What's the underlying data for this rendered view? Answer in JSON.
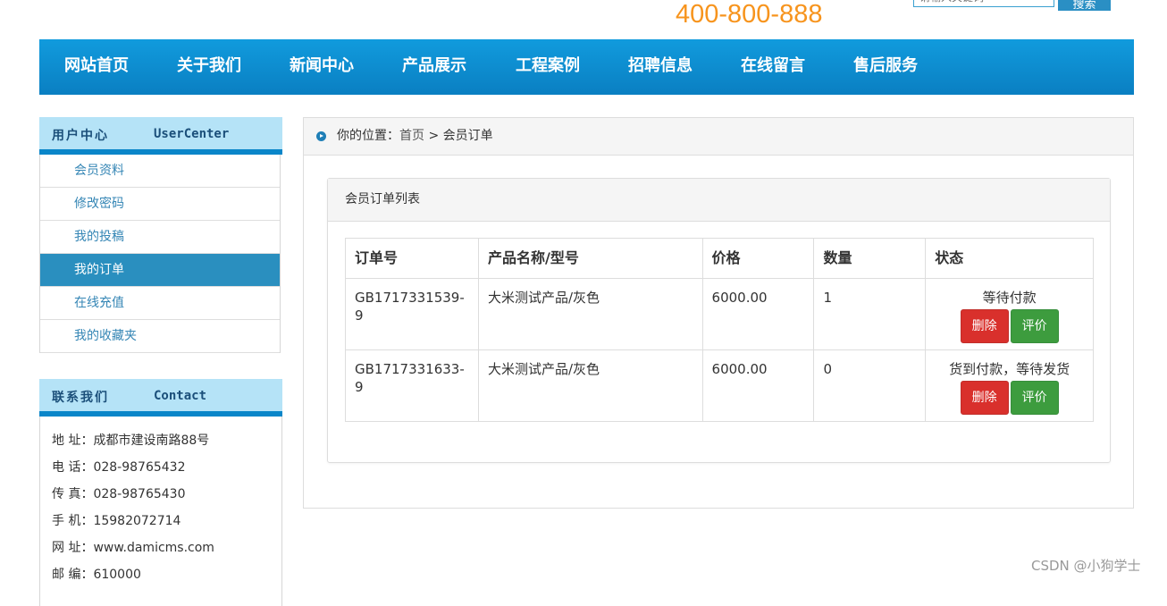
{
  "header": {
    "phone": "400-800-888",
    "search_placeholder": "请输入关键词",
    "search_button": "搜索"
  },
  "nav": {
    "items": [
      "网站首页",
      "关于我们",
      "新闻中心",
      "产品展示",
      "工程案例",
      "招聘信息",
      "在线留言",
      "售后服务"
    ]
  },
  "sidebar": {
    "user_center": {
      "title_cn": "用户中心",
      "title_en": "UserCenter",
      "items": [
        "会员资料",
        "修改密码",
        "我的投稿",
        "我的订单",
        "在线充值",
        "我的收藏夹"
      ],
      "active_index": 3
    },
    "contact": {
      "title_cn": "联系我们",
      "title_en": "Contact",
      "lines": [
        {
          "label": "地  址：",
          "value": "成都市建设南路88号"
        },
        {
          "label": "电  话：",
          "value": "028-98765432"
        },
        {
          "label": "传  真：",
          "value": "028-98765430"
        },
        {
          "label": "手  机：",
          "value": "15982072714"
        },
        {
          "label": "网  址：",
          "value": "www.damicms.com"
        },
        {
          "label": "邮  编：",
          "value": "610000"
        }
      ]
    }
  },
  "breadcrumb": {
    "prefix": "你的位置：",
    "home": "首页",
    "separator": " > ",
    "current": "会员订单"
  },
  "orders_panel": {
    "title": "会员订单列表",
    "columns": [
      "订单号",
      "产品名称/型号",
      "价格",
      "数量",
      "状态"
    ],
    "rows": [
      {
        "order_no": "GB1717331539-9",
        "product": "大米测试产品/灰色",
        "price": "6000.00",
        "qty": "1",
        "status": "等待付款",
        "delete": "删除",
        "rate": "评价"
      },
      {
        "order_no": "GB1717331633-9",
        "product": "大米测试产品/灰色",
        "price": "6000.00",
        "qty": "0",
        "status": "货到付款，等待发货",
        "delete": "删除",
        "rate": "评价"
      }
    ]
  },
  "watermark": "CSDN @小狗学士",
  "colors": {
    "nav_bg": "#0a86c9",
    "phone": "#f7941d",
    "active_menu": "#2a8fbf",
    "delete_button": "#d9302c",
    "rate_button": "#3d9c3e"
  }
}
